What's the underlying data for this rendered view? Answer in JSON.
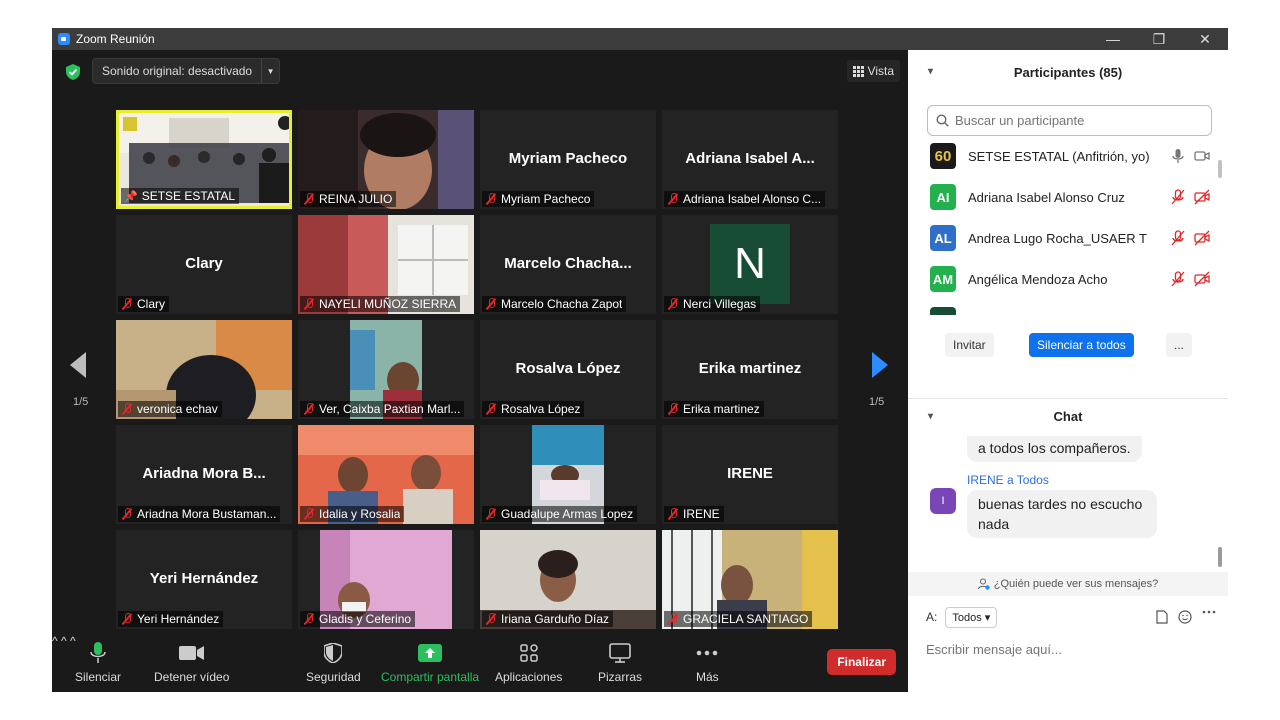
{
  "window": {
    "title": "Zoom Reunión",
    "controls": {
      "minimize": "—",
      "restore": "❐",
      "close": "✕"
    }
  },
  "meeting": {
    "sound_button": "Sonido original: desactivado",
    "view_button": "Vista",
    "page_left": "1/5",
    "page_right": "1/5",
    "tiles": [
      {
        "label": "SETSE ESTATAL",
        "big": "",
        "video": true,
        "pinned": true,
        "active": true
      },
      {
        "label": "REINA JULIO",
        "big": "",
        "video": true
      },
      {
        "label": "Myriam Pacheco",
        "big": "Myriam Pacheco",
        "video": false
      },
      {
        "label": "Adriana Isabel Alonso C...",
        "big": "Adriana Isabel A...",
        "video": false
      },
      {
        "label": "Clary",
        "big": "Clary",
        "video": false
      },
      {
        "label": "NAYELI MUÑOZ SIERRA",
        "big": "",
        "video": true
      },
      {
        "label": "Marcelo Chacha Zapot",
        "big": "Marcelo  Chacha...",
        "video": false
      },
      {
        "label": "Nerci Villegas",
        "big": "",
        "avatar_letter": "N",
        "video": false
      },
      {
        "label": "veronica echav",
        "big": "",
        "video": true
      },
      {
        "label": "Ver, Caixba Paxtian Marl...",
        "big": "",
        "video": true
      },
      {
        "label": "Rosalva López",
        "big": "Rosalva López",
        "video": false
      },
      {
        "label": "Erika martinez",
        "big": "Erika martinez",
        "video": false
      },
      {
        "label": "Ariadna Mora Bustaman...",
        "big": "Ariadna Mora B...",
        "video": false
      },
      {
        "label": "Idalia y Rosalia",
        "big": "",
        "video": true
      },
      {
        "label": "Guadalupe Armas Lopez",
        "big": "",
        "video": true
      },
      {
        "label": "IRENE",
        "big": "IRENE",
        "video": false
      },
      {
        "label": "Yeri Hernández",
        "big": "Yeri Hernández",
        "video": false
      },
      {
        "label": "Gladis y Ceferino",
        "big": "",
        "video": true
      },
      {
        "label": "Iriana Garduño Díaz",
        "big": "",
        "video": true
      },
      {
        "label": "GRACIELA SANTIAGO",
        "big": "",
        "video": true
      }
    ]
  },
  "toolbar": {
    "mute": "Silenciar",
    "video": "Detener vídeo",
    "security": "Seguridad",
    "share": "Compartir pantalla",
    "apps": "Aplicaciones",
    "whiteboards": "Pizarras",
    "more": "Más",
    "end": "Finalizar",
    "share_color": "#2dbe5f",
    "end_color": "#d12c2c"
  },
  "participants": {
    "header": "Participantes (85)",
    "search_placeholder": "Buscar un participante",
    "list": [
      {
        "initials": "60",
        "name": "SETSE ESTATAL (Anfitrión, yo)",
        "color": "#1a1a1a",
        "muted": false
      },
      {
        "initials": "AI",
        "name": "Adriana Isabel Alonso Cruz",
        "color": "#23b14d",
        "muted": true
      },
      {
        "initials": "AL",
        "name": "Andrea Lugo Rocha_USAER T",
        "color": "#2f6fc7",
        "muted": true
      },
      {
        "initials": "AM",
        "name": "Angélica Mendoza Acho",
        "color": "#23b14d",
        "muted": true
      }
    ],
    "invite": "Invitar",
    "mute_all": "Silenciar a todos",
    "more": "..."
  },
  "chat": {
    "header": "Chat",
    "prev_message": "a todos los compañeros.",
    "sender": "IRENE a Todos",
    "sender_initial": "I",
    "message": "buenas tardes no escucho nada",
    "who_can_see": "¿Quién puede ver sus mensajes?",
    "to_label": "A:",
    "to_value": "Todos",
    "input_placeholder": "Escribir mensaje aquí...",
    "accent": "#2d6fd9"
  }
}
